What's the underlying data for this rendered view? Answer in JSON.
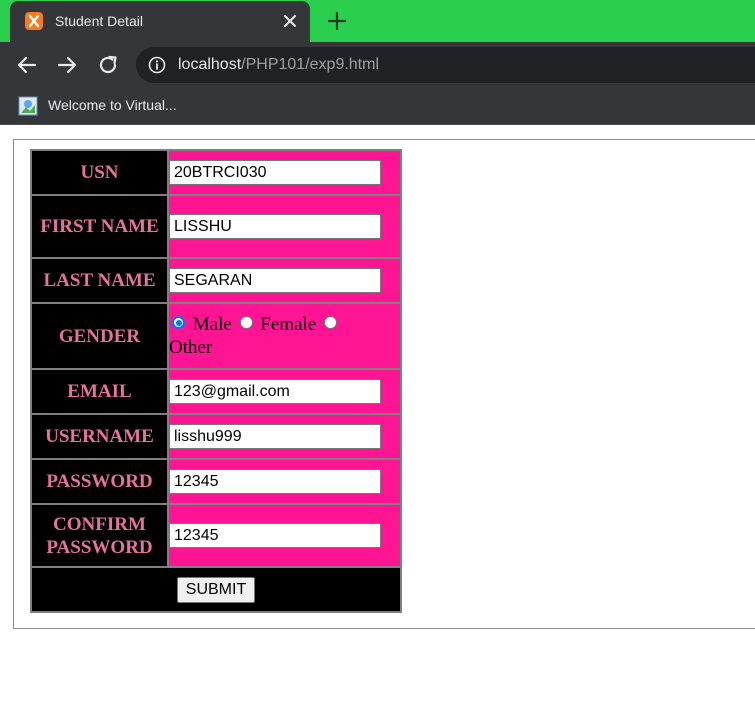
{
  "browser": {
    "tab_title": "Student Detail",
    "url_host": "localhost",
    "url_path": "/PHP101/exp9.html",
    "bookmark_label": "Welcome to Virtual..."
  },
  "form": {
    "fields": {
      "usn": {
        "label": "USN",
        "value": "20BTRCI030"
      },
      "first_name": {
        "label": "FIRST NAME",
        "value": "LISSHU"
      },
      "last_name": {
        "label": "LAST NAME",
        "value": "SEGARAN"
      },
      "gender": {
        "label": "GENDER",
        "options": [
          "Male",
          "Female",
          "Other"
        ],
        "selected": "Male"
      },
      "email": {
        "label": "EMAIL",
        "value": "123@gmail.com"
      },
      "username": {
        "label": "USERNAME",
        "value": "lisshu999"
      },
      "password": {
        "label": "PASSWORD",
        "value": "12345"
      },
      "confirm_password": {
        "label": "CONFIRM PASSWORD",
        "value": "12345"
      }
    },
    "submit_label": "SUBMIT"
  },
  "colors": {
    "tabstrip": "#2bcf4e",
    "label_bg": "#000000",
    "label_text": "#e6739f",
    "value_bg": "#ff1493"
  }
}
